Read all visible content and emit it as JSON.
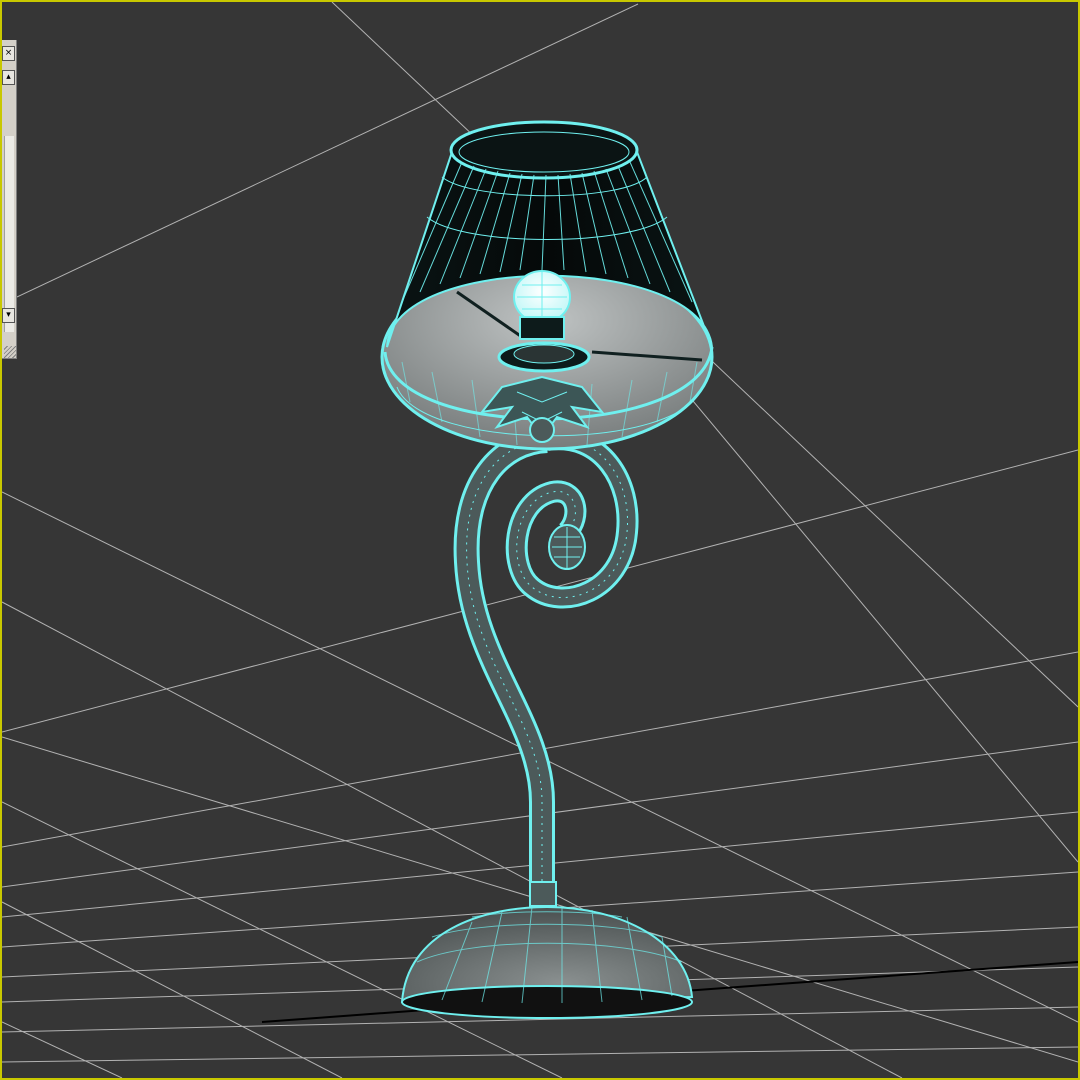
{
  "viewport": {
    "active_border_color": "#c8c800",
    "background_color": "#363636",
    "grid_color": "#c8c8c8",
    "wire_color": "#6ff0ef",
    "object": "table-lamp-wireframe"
  },
  "panel": {
    "close_icon": "close-icon",
    "scroll_up_icon": "arrow-up-icon",
    "scroll_down_icon": "arrow-down-icon",
    "resize_icon": "resize-grip-icon"
  }
}
